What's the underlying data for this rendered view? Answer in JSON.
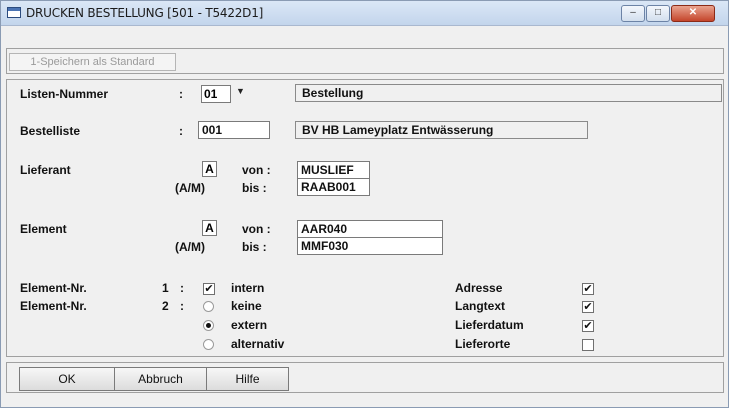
{
  "window": {
    "title": "DRUCKEN BESTELLUNG  [501 - T5422D1]",
    "controls": {
      "minimize": "–",
      "maximize": "□",
      "close": "✕"
    }
  },
  "toolbar": {
    "save_default_label": "1-Speichern als Standard"
  },
  "form": {
    "listen_nummer": {
      "label": "Listen-Nummer",
      "colon": ":",
      "value": "01",
      "description": "Bestellung"
    },
    "bestelliste": {
      "label": "Bestelliste",
      "colon": ":",
      "value": "001",
      "description": "BV HB Lameyplatz Entwässerung"
    },
    "lieferant": {
      "label": "Lieferant",
      "mode_label": "(A/M)",
      "mode_value": "A",
      "from_label": "von :",
      "to_label": "bis :",
      "from_value": "MUSLIEF",
      "to_value": "RAAB001"
    },
    "element": {
      "label": "Element",
      "mode_label": "(A/M)",
      "mode_value": "A",
      "from_label": "von :",
      "to_label": "bis :",
      "from_value": "AAR040",
      "to_value": "MMF030"
    },
    "element_nr_1": {
      "label": "Element-Nr.",
      "num": "1",
      "colon": ":",
      "option_label": "intern",
      "checked": true
    },
    "element_nr_2": {
      "label": "Element-Nr.",
      "num": "2",
      "colon": ":",
      "options": [
        {
          "label": "keine",
          "selected": false
        },
        {
          "label": "extern",
          "selected": true
        },
        {
          "label": "alternativ",
          "selected": false
        }
      ]
    },
    "right_options": [
      {
        "label": "Adresse",
        "checked": true
      },
      {
        "label": "Langtext",
        "checked": true
      },
      {
        "label": "Lieferdatum",
        "checked": true
      },
      {
        "label": "Lieferorte",
        "checked": false
      }
    ]
  },
  "buttons": {
    "ok": "OK",
    "cancel": "Abbruch",
    "help": "Hilfe"
  }
}
